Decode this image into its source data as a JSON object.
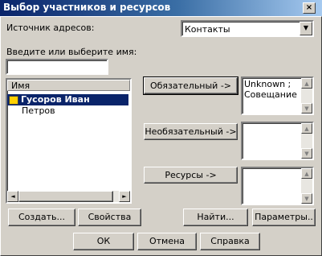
{
  "window": {
    "title": "Выбор участников и ресурсов",
    "close_glyph": "×"
  },
  "source": {
    "label": "Источник адресов:",
    "value": "Контакты"
  },
  "search": {
    "label": "Введите или выберите имя:",
    "value": ""
  },
  "list": {
    "header": "Имя",
    "items": [
      {
        "label": "Гусоров Иван",
        "selected": true,
        "icon": "contact-card-icon"
      },
      {
        "label": "Петров",
        "selected": false
      }
    ]
  },
  "roles": {
    "required_button": "Обязательный ->",
    "required_value": "Unknown ; Совещание",
    "optional_button": "Необязательный ->",
    "optional_value": "",
    "resources_button": "Ресурсы ->",
    "resources_value": ""
  },
  "actions": {
    "create": "Создать...",
    "properties": "Свойства",
    "find": "Найти...",
    "params": "Параметры.."
  },
  "footer": {
    "ok": "ОК",
    "cancel": "Отмена",
    "help": "Справка"
  },
  "glyphs": {
    "down": "▼",
    "up": "▲",
    "left": "◄",
    "right": "►"
  }
}
